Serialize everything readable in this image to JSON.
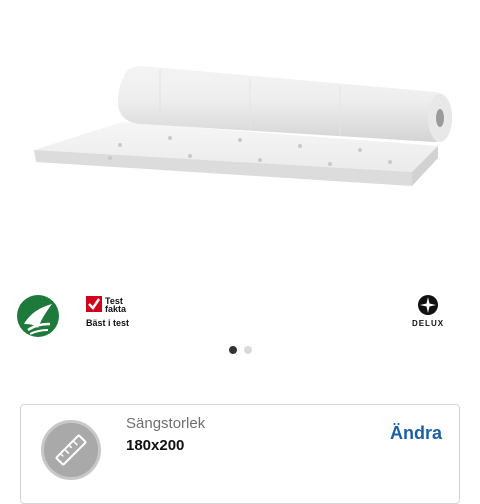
{
  "product": {
    "image_icon": "mattress-topper-rolled-image"
  },
  "badges": {
    "nordic_swan_icon": "nordic-swan-ecolabel-icon",
    "testfakta": {
      "line1": "Test",
      "line2": "fakta",
      "line3": "Bäst i test",
      "check_color": "#d0021b"
    },
    "delux": {
      "label": "DELUX"
    }
  },
  "carousel": {
    "pages": 2,
    "active_index": 0
  },
  "size_selector": {
    "label": "Sängstorlek",
    "value": "180x200",
    "change_label": "Ändra",
    "icon": "ruler-icon",
    "accent_color": "#1b5fa6"
  }
}
